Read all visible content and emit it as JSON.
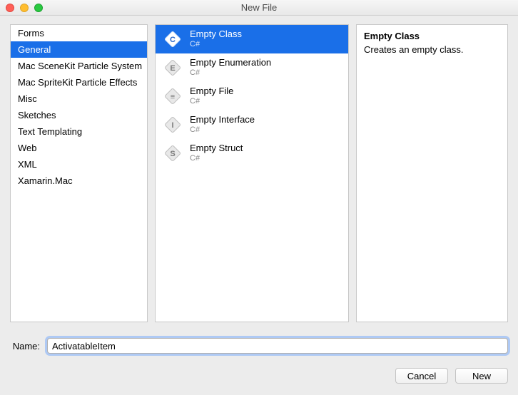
{
  "window": {
    "title": "New File"
  },
  "categories": {
    "items": [
      {
        "label": "Forms"
      },
      {
        "label": "General"
      },
      {
        "label": "Mac SceneKit Particle System"
      },
      {
        "label": "Mac SpriteKit Particle Effects"
      },
      {
        "label": "Misc"
      },
      {
        "label": "Sketches"
      },
      {
        "label": "Text Templating"
      },
      {
        "label": "Web"
      },
      {
        "label": "XML"
      },
      {
        "label": "Xamarin.Mac"
      }
    ],
    "selected_index": 1
  },
  "templates": {
    "items": [
      {
        "label": "Empty Class",
        "sub": "C#",
        "icon": "class-icon"
      },
      {
        "label": "Empty Enumeration",
        "sub": "C#",
        "icon": "enum-icon"
      },
      {
        "label": "Empty File",
        "sub": "C#",
        "icon": "file-icon"
      },
      {
        "label": "Empty Interface",
        "sub": "C#",
        "icon": "interface-icon"
      },
      {
        "label": "Empty Struct",
        "sub": "C#",
        "icon": "struct-icon"
      }
    ],
    "selected_index": 0
  },
  "preview": {
    "title": "Empty Class",
    "description": "Creates an empty class."
  },
  "name_field": {
    "label": "Name:",
    "value": "ActivatableItem"
  },
  "buttons": {
    "cancel": "Cancel",
    "new": "New"
  },
  "icons": {
    "class-icon": "C",
    "enum-icon": "E",
    "file-icon": "≡",
    "interface-icon": "I",
    "struct-icon": "S"
  },
  "colors": {
    "selection": "#1a6fe8"
  }
}
